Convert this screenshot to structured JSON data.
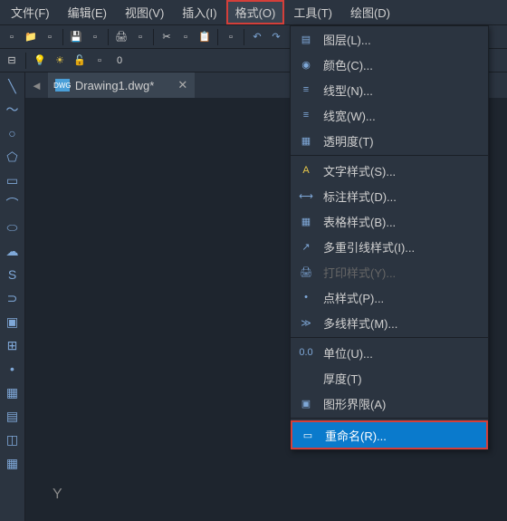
{
  "menubar": {
    "file": "文件(F)",
    "edit": "编辑(E)",
    "view": "视图(V)",
    "insert": "插入(I)",
    "format": "格式(O)",
    "tools": "工具(T)",
    "draw": "绘图(D)"
  },
  "toolbar2": {
    "layer_display": "0"
  },
  "tab": {
    "filename": "Drawing1.dwg*"
  },
  "dropdown": {
    "layer": "图层(L)...",
    "color": "颜色(C)...",
    "linetype": "线型(N)...",
    "lineweight": "线宽(W)...",
    "transparency": "透明度(T)",
    "textstyle": "文字样式(S)...",
    "dimstyle": "标注样式(D)...",
    "tablestyle": "表格样式(B)...",
    "mleaderstyle": "多重引线样式(I)...",
    "plotstyle": "打印样式(Y)...",
    "pointstyle": "点样式(P)...",
    "mlinestyle": "多线样式(M)...",
    "units": "单位(U)...",
    "thickness": "厚度(T)",
    "limits": "图形界限(A)",
    "rename": "重命名(R)..."
  },
  "canvas": {
    "ucs_label": "Y"
  }
}
